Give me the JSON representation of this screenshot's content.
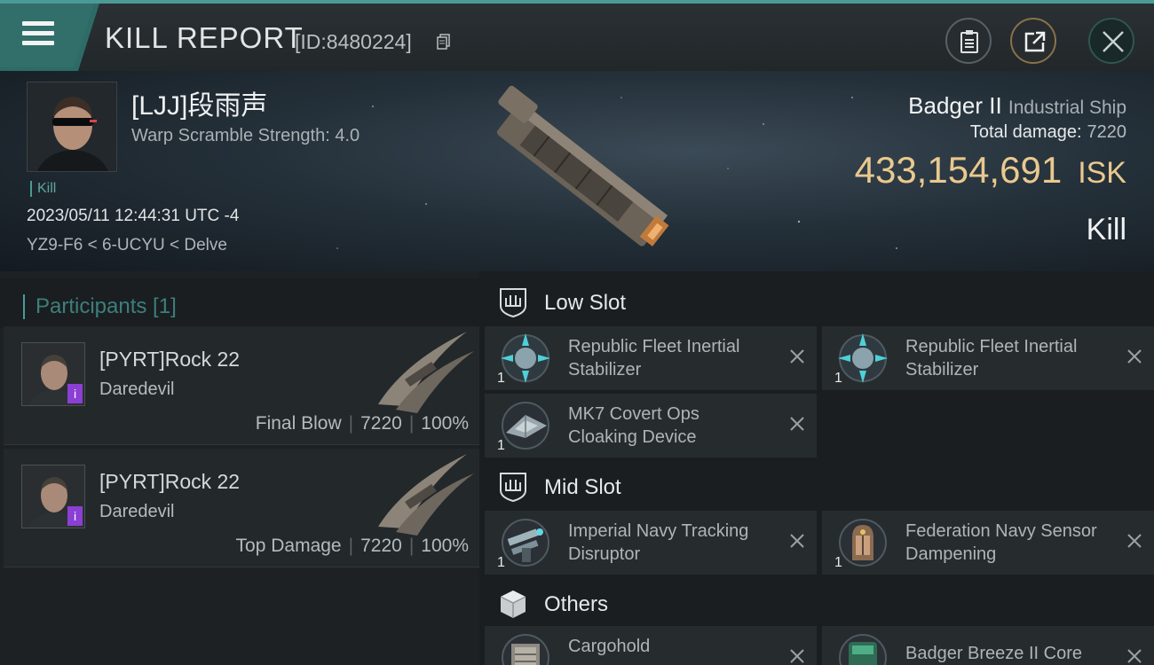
{
  "header": {
    "title": "KILL REPORT",
    "report_id": "[ID:8480224]",
    "icons": [
      "hamburger-menu-icon",
      "copy-icon",
      "clipboard-icon",
      "share-icon",
      "close-icon"
    ]
  },
  "victim": {
    "name": "[LJJ]段雨声",
    "warp_scramble": "Warp Scramble Strength: 4.0",
    "kill_tag": "Kill",
    "timestamp": "2023/05/11 12:44:31 UTC -4",
    "location": "YZ9-F6 < 6-UCYU < Delve",
    "ship_name": "Badger II",
    "ship_class": "Industrial Ship",
    "total_damage_label": "Total damage:",
    "total_damage_value": "7220",
    "isk_value": "433,154,691",
    "isk_unit": "ISK",
    "status": "Kill"
  },
  "participants": {
    "title": "Participants [1]",
    "rows": [
      {
        "name": "[PYRT]Rock 22",
        "ship": "Daredevil",
        "role": "Final Blow",
        "damage": "7220",
        "percent": "100%",
        "badge": "i"
      },
      {
        "name": "[PYRT]Rock 22",
        "ship": "Daredevil",
        "role": "Top Damage",
        "damage": "7220",
        "percent": "100%",
        "badge": "i"
      }
    ]
  },
  "fitting": {
    "low_slot": {
      "title": "Low Slot",
      "modules": [
        {
          "name": "Republic Fleet Inertial Stabilizer",
          "qty": "1",
          "icon": "inertial-stabilizer-icon"
        },
        {
          "name": "Republic Fleet Inertial Stabilizer",
          "qty": "1",
          "icon": "inertial-stabilizer-icon"
        },
        {
          "name": "MK7 Covert Ops Cloaking Device",
          "qty": "1",
          "icon": "cloaking-device-icon"
        }
      ]
    },
    "mid_slot": {
      "title": "Mid Slot",
      "modules": [
        {
          "name": "Imperial Navy Tracking Disruptor",
          "qty": "1",
          "icon": "tracking-disruptor-icon"
        },
        {
          "name": "Federation Navy Sensor Dampening",
          "qty": "1",
          "icon": "sensor-dampener-icon"
        }
      ]
    },
    "others": {
      "title": "Others",
      "modules": [
        {
          "name": "Cargohold",
          "qty": "",
          "icon": "cargohold-icon"
        },
        {
          "name": "Badger Breeze II Core",
          "qty": "",
          "icon": "ship-core-icon"
        }
      ]
    }
  },
  "colors": {
    "accent_teal": "#4c9a96",
    "isk_gold": "#e9c98e",
    "badge_purple": "#8c3fd4"
  }
}
